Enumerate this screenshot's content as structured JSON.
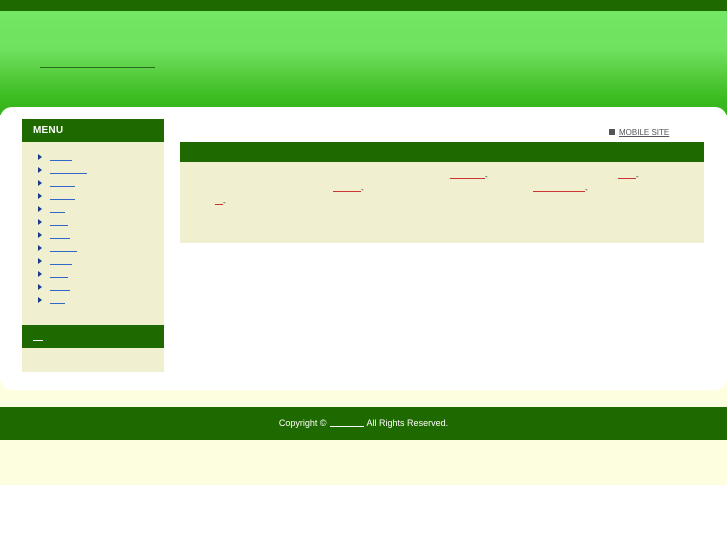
{
  "sidebar": {
    "menu_title": "MENU",
    "menu_items": [
      "",
      "",
      "",
      "",
      "",
      "",
      "",
      "",
      "",
      "",
      "",
      ""
    ]
  },
  "main": {
    "mobile_site_label": "MOBILE SITE"
  },
  "footer": {
    "copyright_prefix": "Copyright ©",
    "copyright_suffix": "All Rights Reserved."
  },
  "colors": {
    "dark_green": "#1f6a00",
    "bright_green": "#73e865",
    "cream": "#f0efd0",
    "link_blue": "#3366cc",
    "link_red": "#cc3333"
  }
}
